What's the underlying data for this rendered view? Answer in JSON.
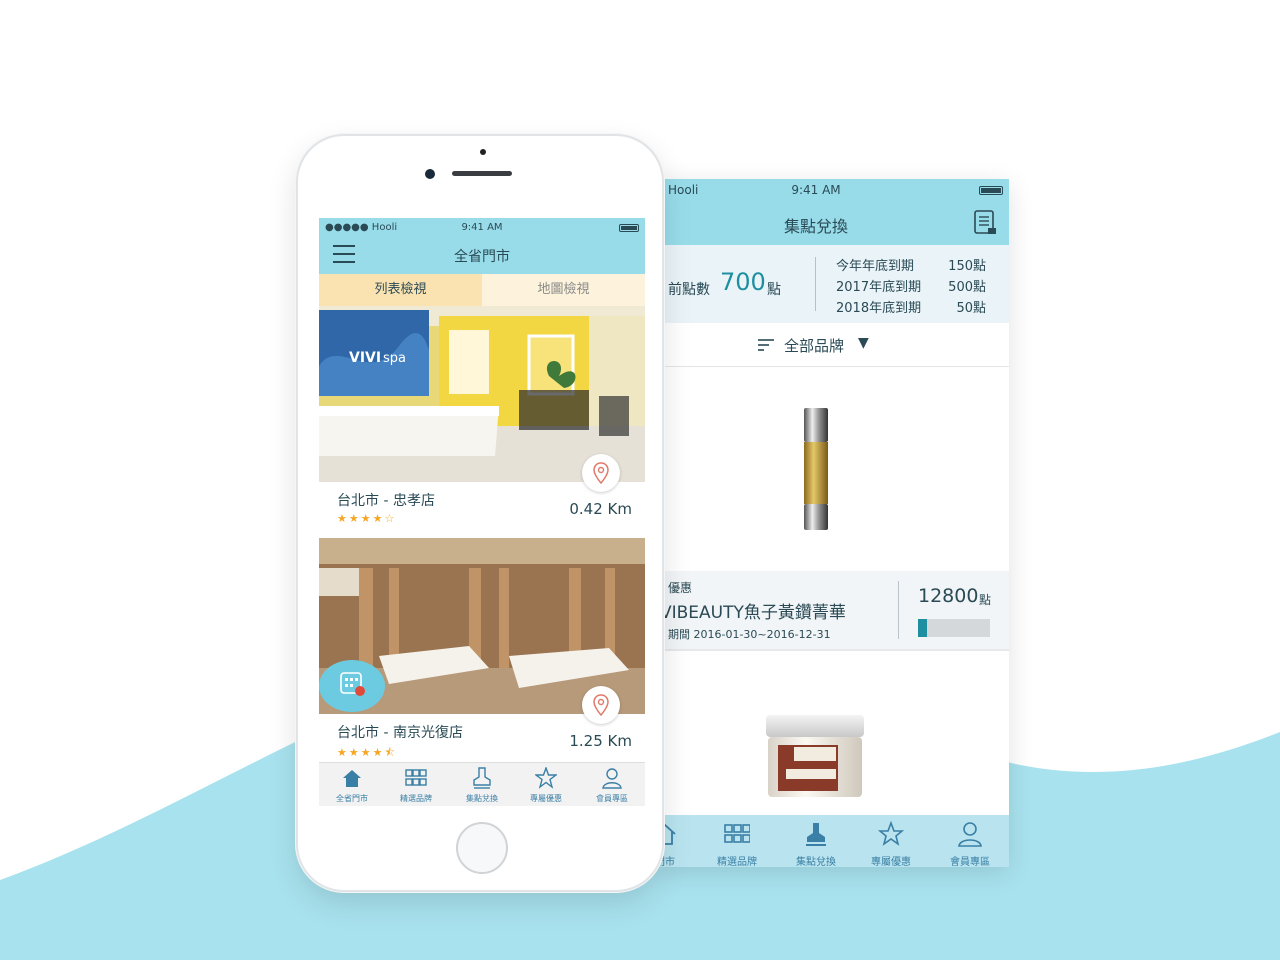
{
  "colors": {
    "header_bg": "#98dcea",
    "tab_active": "#fbe3b1",
    "accent": "#1d8fa0",
    "star": "#f5a623",
    "wave": "#a8e2ee"
  },
  "back_screen": {
    "status": {
      "carrier": "Hooli",
      "time": "9:41 AM"
    },
    "title": "集點兌換",
    "header_icon": "history-list-icon",
    "points": {
      "label": "前點數",
      "value": "700",
      "unit": "點",
      "expiry": [
        {
          "label": "今年年底到期",
          "value": "150點"
        },
        {
          "label": "2017年底到期",
          "value": "500點"
        },
        {
          "label": "2018年底到期",
          "value": "50點"
        }
      ]
    },
    "filter": {
      "label": "全部品牌",
      "arrow": "▼"
    },
    "offer": {
      "tag": "優惠",
      "name": "VIBEAUTY魚子黃鑽菁華",
      "period": "期間 2016-01-30~2016-12-31",
      "cost": "12800",
      "cost_unit": "點",
      "progress": 0.12
    },
    "tabs": [
      {
        "label": "門市",
        "icon": "home-icon"
      },
      {
        "label": "精選品牌",
        "icon": "grid-icon"
      },
      {
        "label": "集點兌換",
        "icon": "stamp-icon"
      },
      {
        "label": "專屬優惠",
        "icon": "star-icon"
      },
      {
        "label": "會員專區",
        "icon": "user-icon"
      }
    ]
  },
  "front_screen": {
    "status": {
      "carrier": "●●●●● Hooli",
      "time": "9:41 AM"
    },
    "title": "全省門市",
    "view_tabs": {
      "list": "列表檢視",
      "map": "地圖檢視"
    },
    "stores": [
      {
        "name": "台北市 - 忠孝店",
        "distance": "0.42 Km",
        "stars": "★★★★☆"
      },
      {
        "name": "台北市 - 南京光復店",
        "distance": "1.25 Km",
        "stars": "★★★★⯪"
      }
    ],
    "tabs": [
      {
        "label": "全省門市",
        "icon": "home-icon"
      },
      {
        "label": "精選品牌",
        "icon": "grid-icon"
      },
      {
        "label": "集點兌換",
        "icon": "stamp-icon"
      },
      {
        "label": "專屬優惠",
        "icon": "star-icon"
      },
      {
        "label": "會員專區",
        "icon": "user-icon"
      }
    ]
  }
}
